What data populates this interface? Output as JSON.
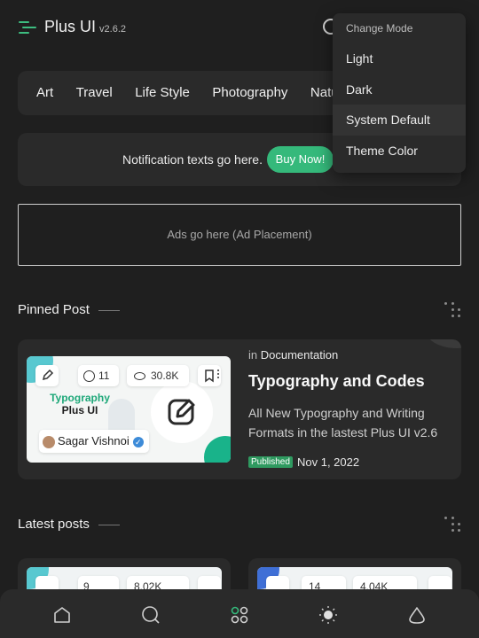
{
  "header": {
    "title": "Plus UI",
    "version": "v2.6.2",
    "menu_icon": "hamburger-icon",
    "search_icon": "search-icon",
    "accent": "#3dbd80"
  },
  "mode_menu": {
    "title": "Change Mode",
    "items": [
      "Light",
      "Dark",
      "System Default",
      "Theme Color"
    ],
    "highlighted": "System Default"
  },
  "categories": [
    "Art",
    "Travel",
    "Life Style",
    "Photography",
    "Nature"
  ],
  "notification": {
    "text": "Notification texts go here.",
    "button_label": "Buy Now!",
    "button_color": "#35b97b"
  },
  "ads": {
    "text": "Ads go here (Ad Placement)"
  },
  "pinned": {
    "section_title": "Pinned Post",
    "post": {
      "comments": "11",
      "views": "30.8K",
      "thumb_title_line1": "Typography",
      "thumb_title_line2": "Plus UI",
      "author": "Sagar Vishnoi",
      "category_prefix": "in",
      "category": "Documentation",
      "title": "Typography and Codes",
      "description": "All New Typography and Writing Formats in the lastest Plus UI v2.6",
      "status": "Published",
      "date": "Nov 1, 2022"
    }
  },
  "latest": {
    "section_title": "Latest posts",
    "cards": [
      {
        "comments": "9",
        "views": "8.02K"
      },
      {
        "comments": "14",
        "views": "4.04K"
      }
    ]
  },
  "bottom_nav": {
    "items": [
      "home-icon",
      "search-icon",
      "apps-icon",
      "theme-icon",
      "top-icon"
    ],
    "active_color": "#35b97b"
  }
}
